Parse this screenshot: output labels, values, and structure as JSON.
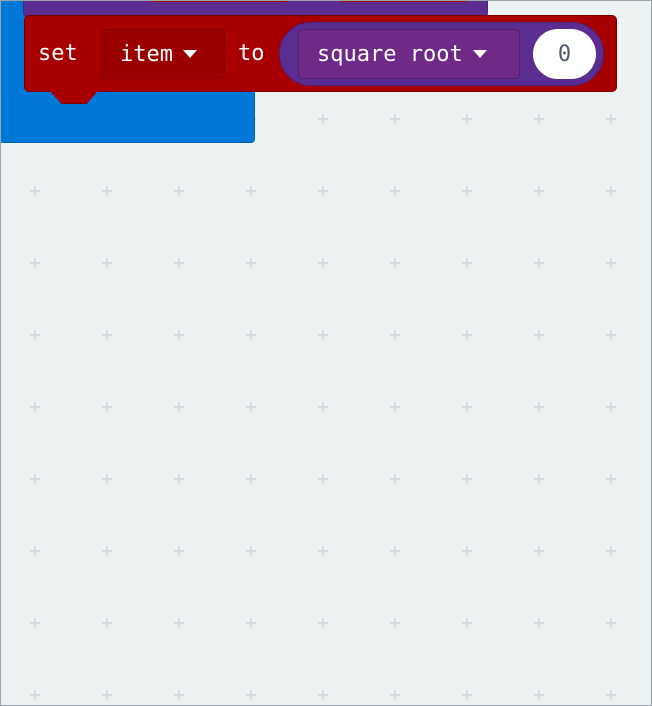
{
  "workspace": {
    "background_color": "#ecf1f2",
    "grid_color": "#cdd4d6"
  },
  "set_block": {
    "keyword_set": "set",
    "variable": "item",
    "keyword_to": "to",
    "color": "#a80000"
  },
  "math_block": {
    "operation": "square root",
    "value": "0",
    "color": "#5c2d91"
  },
  "icons": {
    "dropdown": "caret-down-icon"
  }
}
